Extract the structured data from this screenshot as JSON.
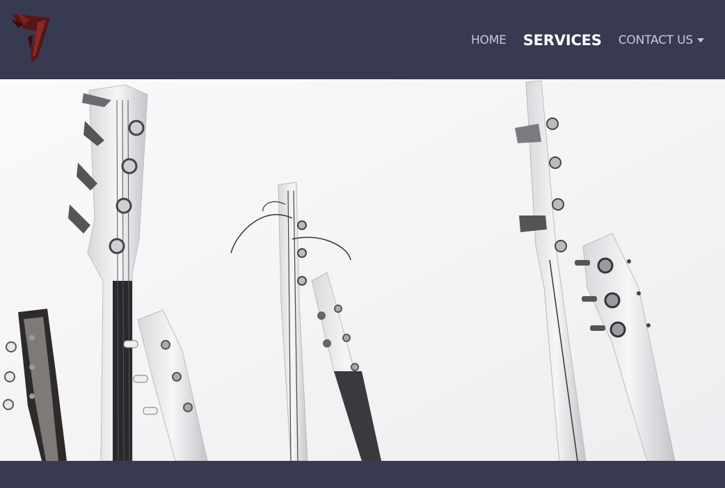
{
  "brand": {
    "logo_icon": "winged-seven-logo",
    "logo_colors": [
      "#6b1a1a",
      "#3a0d10"
    ]
  },
  "nav": {
    "items": [
      {
        "label": "HOME",
        "state": "default"
      },
      {
        "label": "SERVICES",
        "state": "active"
      },
      {
        "label": "CONTACT US",
        "state": "default",
        "has_dropdown": true
      }
    ]
  },
  "hero": {
    "image": "guitar-headstocks-photo",
    "style": "high-key black and white"
  },
  "colors": {
    "nav_bg": "#383a52",
    "nav_text": "#c9cad6",
    "nav_active": "#ffffff",
    "hero_bg": "#f4f4f6"
  }
}
